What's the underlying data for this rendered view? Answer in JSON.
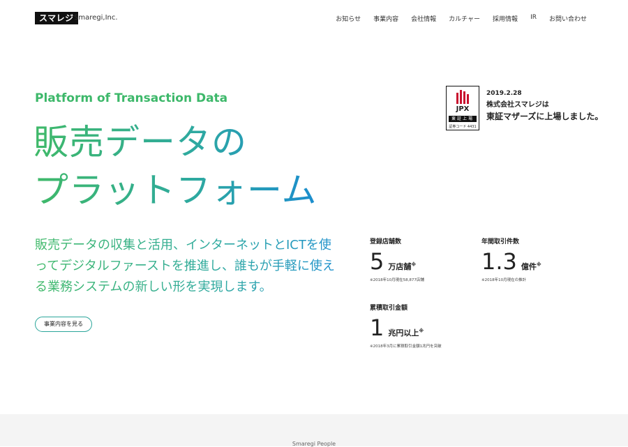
{
  "header": {
    "logo": "スマレジ",
    "company": "Smaregi,Inc.",
    "nav": [
      "お知らせ",
      "事業内容",
      "会社情報",
      "カルチャー",
      "採用情報",
      "IR",
      "お問い合わせ"
    ]
  },
  "hero": {
    "tagline": "Platform of Transaction Data",
    "headline_line1": "販売データの",
    "headline_line2": "プラットフォーム",
    "lead": "販売データの収集と活用、インターネットとICTを使ってデジタルファーストを推進し、誰もが手軽に使える業務システムの新しい形を実現します。",
    "cta": "事業内容を見る"
  },
  "listing": {
    "jpx": "JPX",
    "jpx_band": "東証上場",
    "jpx_code": "証券コード 4431",
    "date": "2019.2.28",
    "line1": "株式会社スマレジは",
    "line2": "東証マザーズに上場しました。"
  },
  "stats": [
    {
      "label": "登録店舗数",
      "number": "5",
      "unit": "万店舗",
      "mark": "※",
      "note": "※2018年10月現在58,877店舗"
    },
    {
      "label": "年間取引件数",
      "number": "1.3",
      "unit": "億件",
      "mark": "※",
      "note": "※2018年10月現在の推計"
    },
    {
      "label": "累積取引金額",
      "number": "1",
      "unit": "兆円以上",
      "mark": "※",
      "note": "※2018年3月に累積取引金額1兆円を突破"
    }
  ],
  "footer_band": {
    "label": "Smaregi People"
  },
  "colors": {
    "green": "#3fb968",
    "blue": "#1a8bd2",
    "jpx_red": "#c8102e"
  }
}
